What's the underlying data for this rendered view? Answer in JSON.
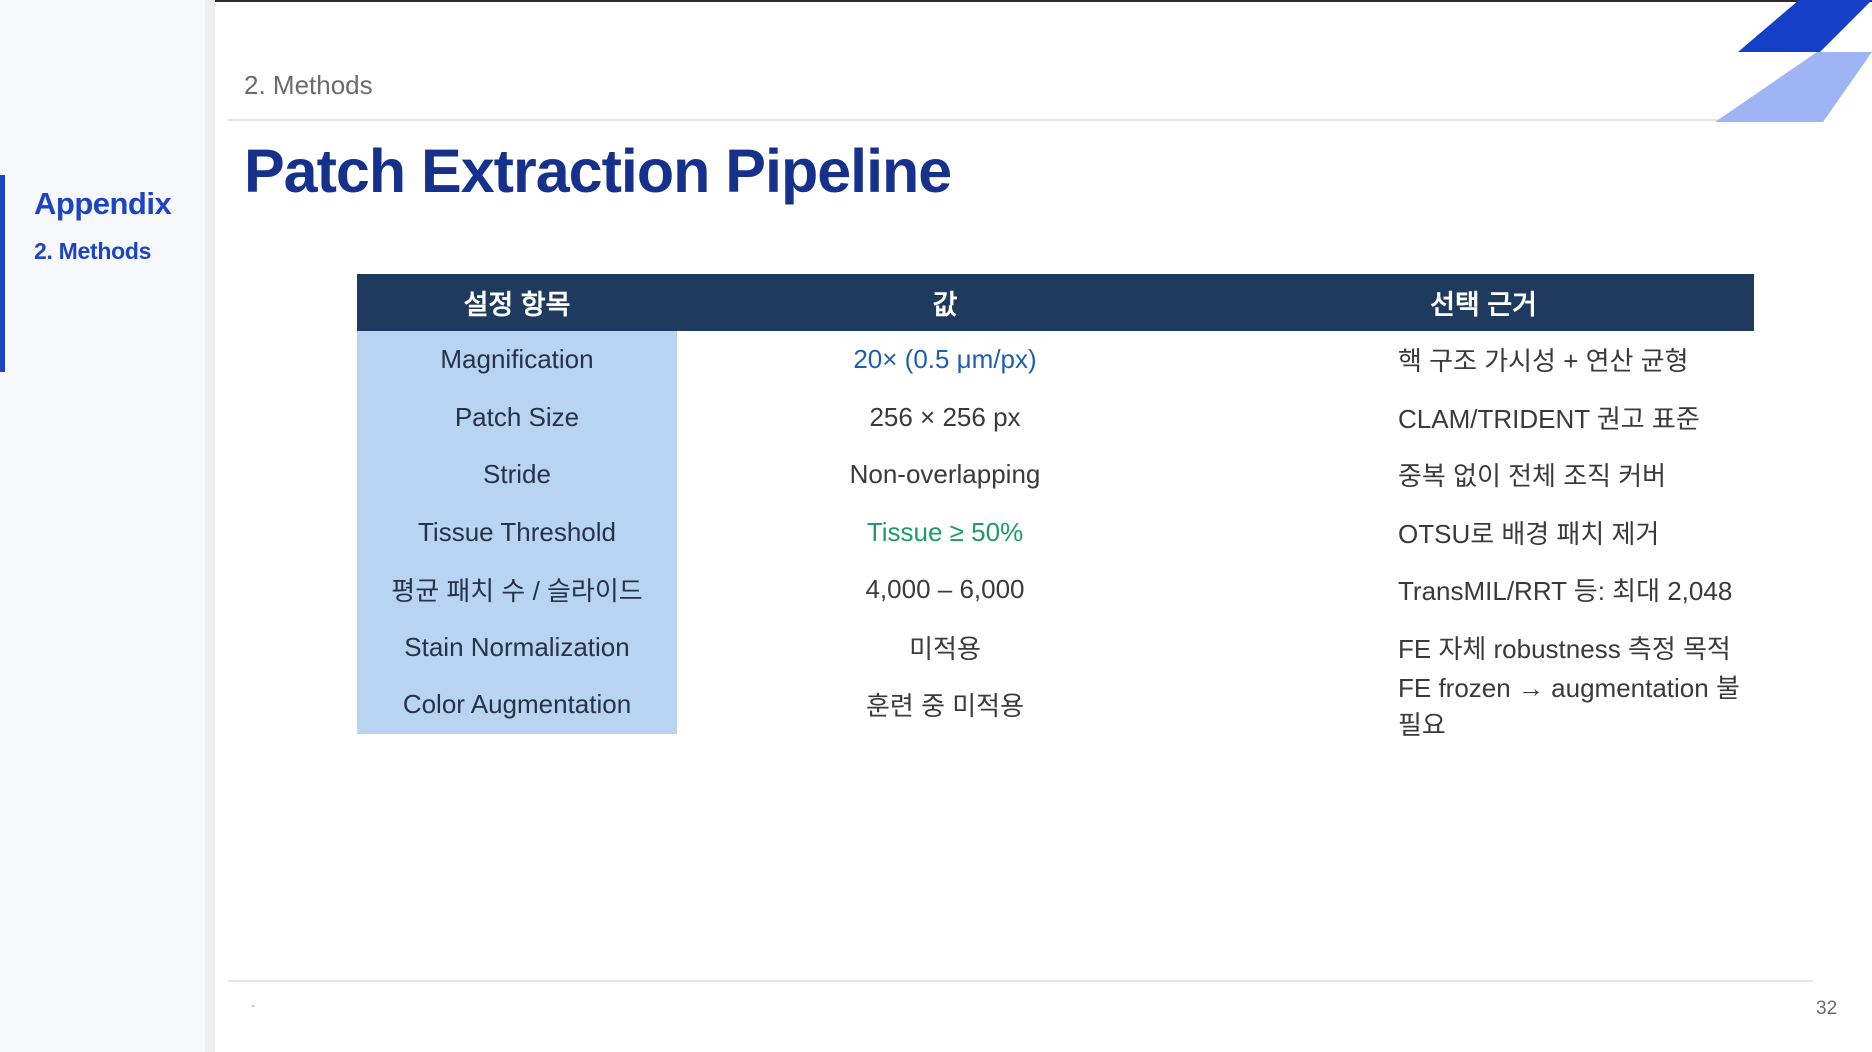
{
  "sidebar": {
    "section": "Appendix",
    "subsection": "2. Methods"
  },
  "header": {
    "breadcrumb": "2. Methods",
    "title": "Patch Extraction Pipeline"
  },
  "table": {
    "headers": [
      "설정 항목",
      "값",
      "선택 근거"
    ],
    "rows": [
      {
        "param": "Magnification",
        "value": "20× (0.5 μm/px)",
        "reason": "핵 구조 가시성 + 연산 균형",
        "value_color": "#1f5fb0"
      },
      {
        "param": "Patch Size",
        "value": "256 × 256 px",
        "reason": "CLAM/TRIDENT 권고 표준",
        "value_color": "#3a3a3a"
      },
      {
        "param": "Stride",
        "value": "Non-overlapping",
        "reason": "중복 없이 전체 조직 커버",
        "value_color": "#3a3a3a"
      },
      {
        "param": "Tissue Threshold",
        "value": "Tissue ≥ 50%",
        "reason": "OTSU로 배경 패치 제거",
        "value_color": "#1f9a6a"
      },
      {
        "param": "평균 패치 수 / 슬라이드",
        "value": "4,000 – 6,000",
        "reason": "TransMIL/RRT 등: 최대 2,048",
        "value_color": "#3a3a3a"
      },
      {
        "param": "Stain Normalization",
        "value": "미적용",
        "reason": "FE 자체 robustness 측정 목적",
        "value_color": "#3a3a3a"
      },
      {
        "param": "Color Augmentation",
        "value": "훈련 중 미적용",
        "reason": "FE frozen → augmentation 불필요",
        "value_color": "#3a3a3a"
      }
    ]
  },
  "colors": {
    "accent": "#1c44c4",
    "title": "#15318c",
    "header_bg": "#1e3a5f",
    "param_bg": "#b8d4f1"
  },
  "footer": {
    "mark": "-",
    "page_number": "32"
  }
}
